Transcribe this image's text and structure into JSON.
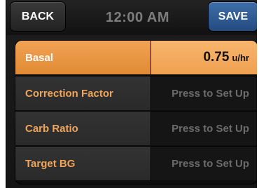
{
  "header": {
    "back_label": "BACK",
    "time": "12:00 AM",
    "save_label": "SAVE"
  },
  "settings": [
    {
      "label": "Basal",
      "value": "0.75",
      "unit": "u/hr",
      "selected": true
    },
    {
      "label": "Correction Factor",
      "value": "Press to Set Up",
      "selected": false
    },
    {
      "label": "Carb Ratio",
      "value": "Press to Set Up",
      "selected": false
    },
    {
      "label": "Target BG",
      "value": "Press to Set Up",
      "selected": false
    }
  ],
  "colors": {
    "accent_orange": "#f0a55a",
    "save_blue": "#2f5d96",
    "background": "#141414"
  }
}
